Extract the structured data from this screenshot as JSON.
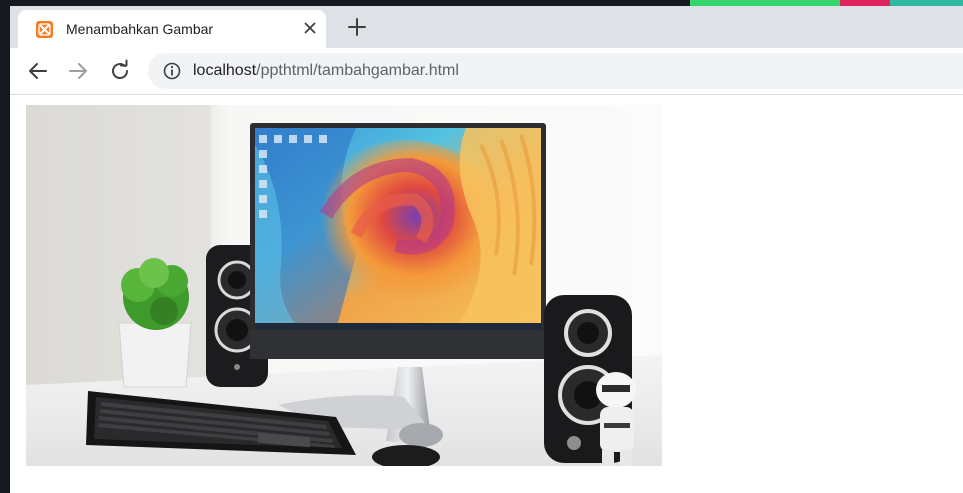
{
  "window": {
    "tab_title": "Menambahkan Gambar",
    "favicon": "xampp-icon",
    "colors": {
      "tabstrip": "#dee1e6",
      "favicon": "#fb7a24",
      "url_path": "#5f6368"
    }
  },
  "toolbar": {
    "url_host": "localhost",
    "url_path": "/ppthtml/tambahgambar.html",
    "icons": [
      "back-arrow-icon",
      "forward-arrow-icon",
      "reload-icon",
      "info-icon"
    ]
  },
  "page": {
    "image_alt": "Monitor, speakers, keyboard, mouse and plant on a white desk"
  }
}
